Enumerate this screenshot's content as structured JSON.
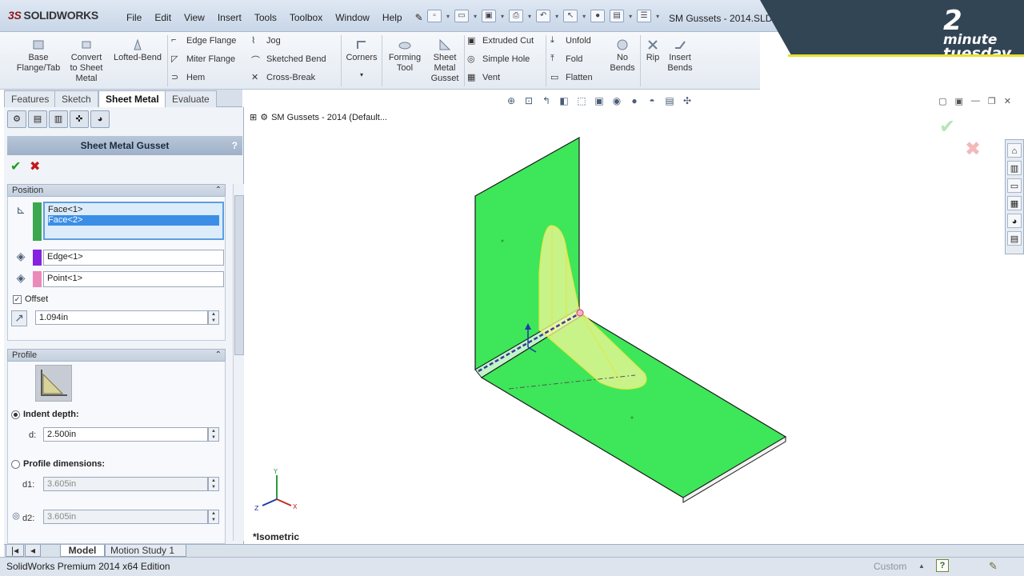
{
  "app": {
    "logo": "SOLIDWORKS",
    "logo_prefix": "3S",
    "doc_title": "SM Gussets - 2014.SLD...",
    "menus": [
      "File",
      "Edit",
      "View",
      "Insert",
      "Tools",
      "Toolbox",
      "Window",
      "Help"
    ]
  },
  "brand": {
    "num": "2",
    "line1": "minute",
    "line2": "tuesday"
  },
  "command_manager": {
    "base_flange": "Base\nFlange/Tab",
    "convert": "Convert\nto Sheet\nMetal",
    "lofted_bend": "Lofted-Bend",
    "edge_flange": "Edge Flange",
    "miter_flange": "Miter Flange",
    "hem": "Hem",
    "jog": "Jog",
    "sketched_bend": "Sketched Bend",
    "cross_break": "Cross-Break",
    "corners": "Corners",
    "forming_tool": "Forming\nTool",
    "sheet_metal_gusset": "Sheet\nMetal\nGusset",
    "extruded_cut": "Extruded Cut",
    "simple_hole": "Simple Hole",
    "vent": "Vent",
    "unfold": "Unfold",
    "fold": "Fold",
    "flatten": "Flatten",
    "no_bends": "No\nBends",
    "rip": "Rip",
    "insert_bends": "Insert\nBends"
  },
  "tabs": [
    "Features",
    "Sketch",
    "Sheet Metal",
    "Evaluate"
  ],
  "property_manager": {
    "title": "Sheet Metal Gusset",
    "help": "?",
    "position_header": "Position",
    "faces": [
      "Face<1>",
      "Face<2>"
    ],
    "edge": "Edge<1>",
    "point": "Point<1>",
    "offset_label": "Offset",
    "offset_checked": true,
    "offset_value": "1.094in",
    "profile_header": "Profile",
    "indent_label": "Indent depth:",
    "d_label": "d:",
    "d_value": "2.500in",
    "profile_dims_label": "Profile dimensions:",
    "d1_label": "d1:",
    "d1_value": "3.605in",
    "d2_label": "d2:",
    "d2_value": "3.605in"
  },
  "viewport": {
    "tree_root": "SM Gussets - 2014  (Default...",
    "view_label": "*Isometric"
  },
  "model_tabs": [
    "Model",
    "Motion Study 1"
  ],
  "status": {
    "text": "SolidWorks Premium 2014 x64 Edition",
    "custom": "Custom"
  },
  "colors": {
    "face_green": "#3ee65a",
    "gusset_yellow": "#f6f79a",
    "highlight_blue": "#3b8ee6"
  }
}
